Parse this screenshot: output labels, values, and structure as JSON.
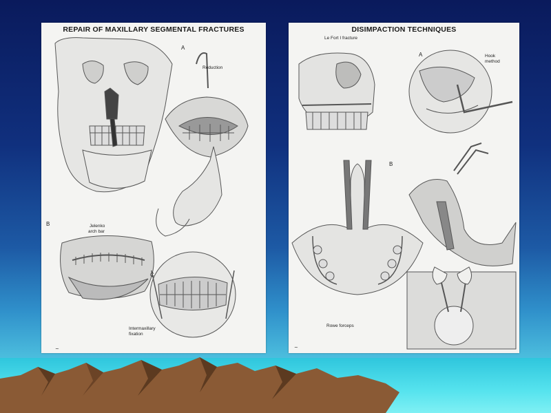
{
  "left_plate": {
    "title": "REPAIR OF MAXILLARY SEGMENTAL FRACTURES",
    "label_a": "A",
    "label_reduction": "Reduction",
    "label_b": "B",
    "label_arch_bar_1": "Jelenko",
    "label_arch_bar_2": "arch bar",
    "label_c": "C",
    "label_fixation_1": "Intermaxillary",
    "label_fixation_2": "fixation"
  },
  "right_plate": {
    "title": "DISIMPACTION TECHNIQUES",
    "label_lefort": "Le Fort I fracture",
    "label_a": "A",
    "label_hook_1": "Hook",
    "label_hook_2": "method",
    "label_b": "B",
    "label_rowe": "Rowe forceps"
  },
  "colors": {
    "sky_top": "#0a1a5c",
    "sea": "#4fd8e8",
    "mountain": "#8a5a35",
    "plate": "#f4f4f2"
  }
}
